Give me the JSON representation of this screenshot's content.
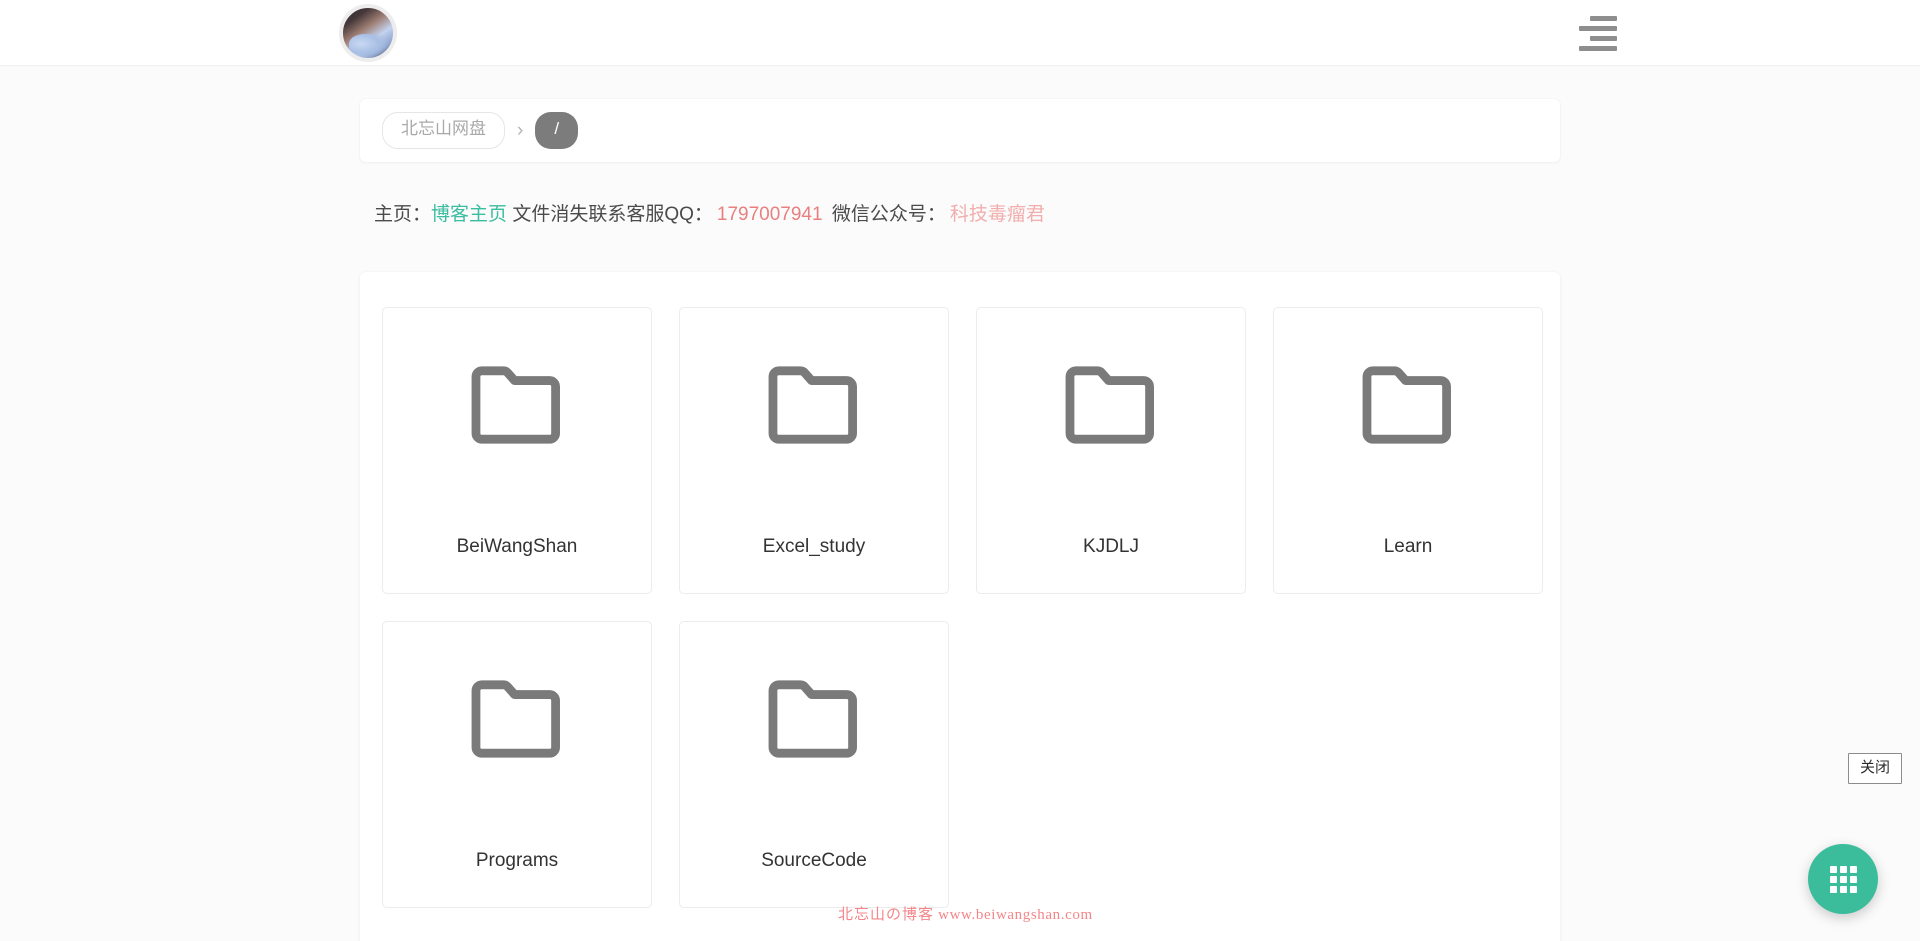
{
  "header": {
    "avatar_alt": "user-avatar",
    "menu_icon": "hamburger-menu-icon"
  },
  "breadcrumb": {
    "root_label": "北忘山网盘",
    "separator": "›",
    "current_label": "/"
  },
  "notice": {
    "home_label": "主页：",
    "blog_link": "博客主页",
    "qq_label": "文件消失联系客服QQ：",
    "qq_number": "1797007941",
    "wechat_label": "微信公众号：",
    "wechat_value": "科技毒瘤君"
  },
  "files": {
    "items": [
      {
        "name": "BeiWangShan",
        "type": "folder",
        "icon": "folder-icon"
      },
      {
        "name": "Excel_study",
        "type": "folder",
        "icon": "folder-icon"
      },
      {
        "name": "KJDLJ",
        "type": "folder",
        "icon": "folder-icon"
      },
      {
        "name": "Learn",
        "type": "folder",
        "icon": "folder-icon"
      },
      {
        "name": "Programs",
        "type": "folder",
        "icon": "folder-icon"
      },
      {
        "name": "SourceCode",
        "type": "folder",
        "icon": "folder-icon"
      }
    ]
  },
  "close_badge": {
    "label": "关闭"
  },
  "fab": {
    "icon": "grid-apps-icon"
  },
  "watermark": {
    "site_cn": "北忘山の博客",
    "site_url": "www.beiwangshan.com"
  },
  "colors": {
    "accent": "#3bbd9c",
    "blog_link": "#3bbda0",
    "qq_number": "#e8807f",
    "wechat": "#f2aeae",
    "folder": "#7a7a7a",
    "crumb_current_bg": "#7c7c7c",
    "watermark": "#f4868a",
    "page_bg": "#fbfbfb"
  }
}
